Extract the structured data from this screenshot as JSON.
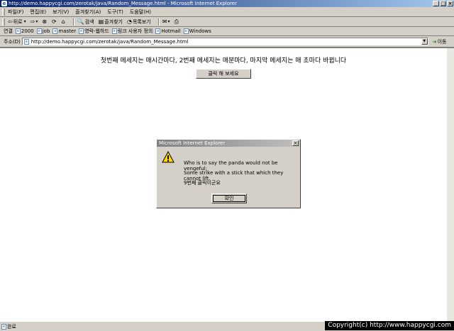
{
  "window": {
    "title": "http://demo.happycgi.com/zerotak/java/Random_Message.html - Microsoft Internet Explorer"
  },
  "menu": [
    "파일(F)",
    "편집(E)",
    "보기(V)",
    "즐겨찾기(A)",
    "도구(T)",
    "도움말(H)"
  ],
  "toolbar": {
    "back": "뒤로",
    "search": "검색",
    "favorites": "즐겨찾기",
    "history": "목록보기"
  },
  "links": {
    "label": "연결",
    "items": [
      "2000",
      "job",
      "master",
      "영락-웹하드",
      "링크 사용자 정의",
      "Hotmail",
      "Windows"
    ]
  },
  "address": {
    "label": "주소(D)",
    "url": "http://demo.happycgi.com/zerotak/java/Random_Message.html",
    "go": "이동"
  },
  "page": {
    "heading": "첫번째 메세지는 매시간마다, 2번째 메세지는 매분마다, 마지막 메세지는 매 초마다 바뀝니다",
    "button": "클릭 해 보세요"
  },
  "dialog": {
    "title": "Microsoft Internet Explorer",
    "line1": "Who is to say the panda would not be vengeful;",
    "line2": "Some strike with a stick that which they cannot lift.",
    "line3": "9번째 클릭이군요",
    "ok": "확인"
  },
  "status": {
    "text": "완료"
  },
  "watermark": "Copyright(c) http://www.happycgi.com"
}
